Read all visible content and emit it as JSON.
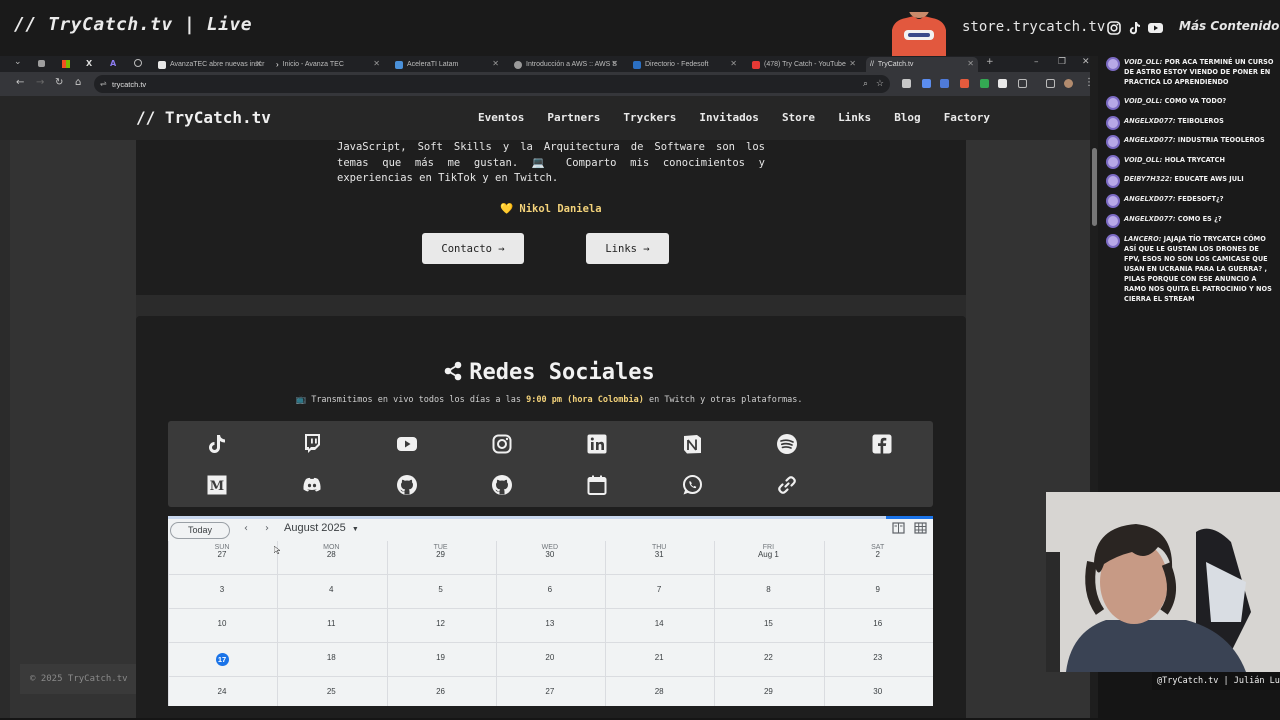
{
  "overlay": {
    "title": "// TryCatch.tv | Live",
    "store": "store.trycatch.tv",
    "more": "Más Contenido",
    "icons": [
      "instagram-icon",
      "tiktok-icon",
      "youtube-icon"
    ]
  },
  "browser": {
    "tabs": [
      {
        "label": "AvanzaTEC abre nuevas inscr",
        "color": "#e8e8e8"
      },
      {
        "label": "Inicio - Avanza TEC",
        "color": "#f1f1f1"
      },
      {
        "label": "AceleraTI Latam",
        "color": "#4a90d9"
      },
      {
        "label": "Introducción a AWS :: AWS S",
        "color": "#9a9a9a"
      },
      {
        "label": "Directorio - Fedesoft",
        "color": "#2b6fc2"
      },
      {
        "label": "(478) Try Catch - YouTube",
        "color": "#e53935"
      },
      {
        "label": "TryCatch.tv",
        "color": "#e0e0e0"
      }
    ],
    "new_tab": "+",
    "url": "trycatch.tv"
  },
  "site": {
    "logo": "// TryCatch.tv",
    "nav": [
      "Eventos",
      "Partners",
      "Tryckers",
      "Invitados",
      "Store",
      "Links",
      "Blog",
      "Factory"
    ],
    "bio_lines": [
      "JavaScript, Soft Skills y la Arquitectura de Software son los",
      "temas que más me gustan. 💻 Comparto mis conocimientos y",
      "experiencias en TikTok y en Twitch."
    ],
    "signature": "💛 Nikol Daniela",
    "buttons": {
      "contacto": "Contacto →",
      "links": "Links →"
    },
    "redes": {
      "title": "Redes Sociales",
      "sub_pre": "📺 Transmitimos en vivo todos los días a las",
      "sub_time": "9:00 pm (hora Colombia)",
      "sub_post": "en Twitch y otras plataformas."
    },
    "social_icons": [
      "tiktok-icon",
      "twitch-icon",
      "youtube-icon",
      "instagram-icon",
      "linkedin-icon",
      "notion-icon",
      "spotify-icon",
      "facebook-icon",
      "medium-icon",
      "discord-icon",
      "github-icon",
      "github-icon",
      "calendar-icon",
      "whatsapp-icon",
      "link-icon"
    ],
    "footer": "© 2025 TryCatch.tv"
  },
  "calendar": {
    "today": "Today",
    "month": "August 2025",
    "dows": [
      "SUN",
      "MON",
      "TUE",
      "WED",
      "THU",
      "FRI",
      "SAT"
    ],
    "weeks": [
      [
        "27",
        "28",
        "29",
        "30",
        "31",
        "Aug 1",
        "2"
      ],
      [
        "3",
        "4",
        "5",
        "6",
        "7",
        "8",
        "9"
      ],
      [
        "10",
        "11",
        "12",
        "13",
        "14",
        "15",
        "16"
      ],
      [
        "17",
        "18",
        "19",
        "20",
        "21",
        "22",
        "23"
      ],
      [
        "24",
        "25",
        "26",
        "27",
        "28",
        "29",
        "30"
      ]
    ],
    "today_date": "17"
  },
  "chat": [
    {
      "user": "VOID_OLL:",
      "text": "POR ACA TERMINÉ UN CURSO DE ASTRO ESTOY VIENDO DE PONER EN PRACTICA LO APRENDIENDO"
    },
    {
      "user": "VOID_OLL:",
      "text": "COMO VA TODO?"
    },
    {
      "user": "ANGELXD077:",
      "text": "TEIBOLEROS"
    },
    {
      "user": "ANGELXD077:",
      "text": "INDUSTRIA TEOOLEROS"
    },
    {
      "user": "VOID_OLL:",
      "text": "HOLA TRYCATCH"
    },
    {
      "user": "DEIBY7H322:",
      "text": "EDUCATE AWS JULI"
    },
    {
      "user": "ANGELXD077:",
      "text": "FEDESOFT¿?"
    },
    {
      "user": "ANGELXD077:",
      "text": "COMO ES ¿?"
    },
    {
      "user": "LANCERO:",
      "text": "JAJAJA TÍO TRYCATCH CÓMO ASÍ QUE LE GUSTAN LOS DRONES DE FPV, ESOS NO SON LOS CAMICASE QUE USAN EN UCRANIA PARA LA GUERRA? , PILAS PORQUE CON ESE ANUNCIO A RAMO NOS QUITA EL PATROCINIO Y NOS CIERRA EL STREAM"
    }
  ],
  "credit": "@TryCatch.tv | Julián Luna"
}
